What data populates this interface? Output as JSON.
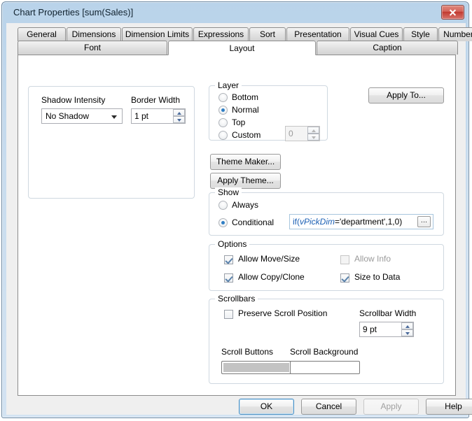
{
  "window": {
    "title": "Chart Properties [sum(Sales)]",
    "close_label": "Close"
  },
  "tabs_row1": [
    {
      "label": "General",
      "selected": false
    },
    {
      "label": "Dimensions",
      "selected": false
    },
    {
      "label": "Dimension Limits",
      "selected": false
    },
    {
      "label": "Expressions",
      "selected": false
    },
    {
      "label": "Sort",
      "selected": false
    },
    {
      "label": "Presentation",
      "selected": false
    },
    {
      "label": "Visual Cues",
      "selected": false
    },
    {
      "label": "Style",
      "selected": false
    },
    {
      "label": "Number",
      "selected": false
    }
  ],
  "tabs_row2": [
    {
      "label": "Font",
      "selected": false
    },
    {
      "label": "Layout",
      "selected": true
    },
    {
      "label": "Caption",
      "selected": false
    }
  ],
  "left_panel": {
    "shadow_intensity": {
      "label": "Shadow Intensity",
      "value": "No Shadow"
    },
    "border_width": {
      "label": "Border Width",
      "value": "1 pt"
    }
  },
  "apply_to": {
    "label": "Apply To..."
  },
  "layer": {
    "title": "Layer",
    "options": [
      {
        "label": "Bottom",
        "checked": false
      },
      {
        "label": "Normal",
        "checked": true
      },
      {
        "label": "Top",
        "checked": false
      },
      {
        "label": "Custom",
        "checked": false
      }
    ],
    "custom_value": "0"
  },
  "theme": {
    "theme_maker_label": "Theme Maker...",
    "apply_theme_label": "Apply Theme..."
  },
  "show": {
    "title": "Show",
    "always_label": "Always",
    "always_checked": false,
    "conditional_label": "Conditional",
    "conditional_checked": true,
    "expression": {
      "keyword": "if(",
      "variable": "vPickDim",
      "rest": "='department',1,0)",
      "full": "if(vPickDim='department',1,0)",
      "browse_label": "..."
    }
  },
  "options": {
    "title": "Options",
    "items": [
      {
        "label": "Allow Move/Size",
        "checked": true,
        "disabled": false
      },
      {
        "label": "Allow Info",
        "checked": false,
        "disabled": true
      },
      {
        "label": "Allow Copy/Clone",
        "checked": true,
        "disabled": false
      },
      {
        "label": "Size to Data",
        "checked": true,
        "disabled": false
      }
    ]
  },
  "scrollbars": {
    "title": "Scrollbars",
    "preserve_scroll_label": "Preserve Scroll Position",
    "preserve_scroll_checked": false,
    "scrollbar_width_label": "Scrollbar Width",
    "scrollbar_width_value": "9 pt",
    "scroll_buttons_label": "Scroll Buttons",
    "scroll_buttons_color": "#c3c3c3",
    "scroll_background_label": "Scroll Background",
    "scroll_background_color": "#ffffff"
  },
  "footer": {
    "ok_label": "OK",
    "cancel_label": "Cancel",
    "apply_label": "Apply",
    "help_label": "Help"
  }
}
